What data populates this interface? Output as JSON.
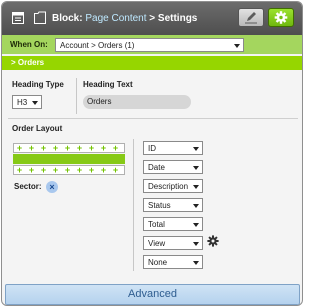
{
  "header": {
    "prefix": "Block:",
    "link": "Page Content",
    "suffix": "> Settings"
  },
  "when_on": {
    "label": "When On:",
    "value": "Account > Orders (1)"
  },
  "breadcrumb": {
    "text": "> Orders"
  },
  "heading_type": {
    "label": "Heading Type",
    "value": "H3"
  },
  "heading_text": {
    "label": "Heading Text",
    "value": "Orders"
  },
  "order_layout": {
    "label": "Order Layout",
    "sector_label": "Sector:"
  },
  "fields": [
    "ID",
    "Date",
    "Description",
    "Status",
    "Total",
    "View",
    "None"
  ],
  "footer": {
    "advanced_label": "Advanced"
  },
  "colors": {
    "header_bg": "#5a5a5a",
    "when_bar": "#a4d65e",
    "orders_bar": "#96d600",
    "accent_green": "#7ac70c",
    "advanced_bg": "#c3daf1"
  },
  "icons": [
    "calendar-icon",
    "page-icon",
    "pencil-icon",
    "gear-icon",
    "plus-icon",
    "close-icon",
    "small-gear-icon"
  ]
}
